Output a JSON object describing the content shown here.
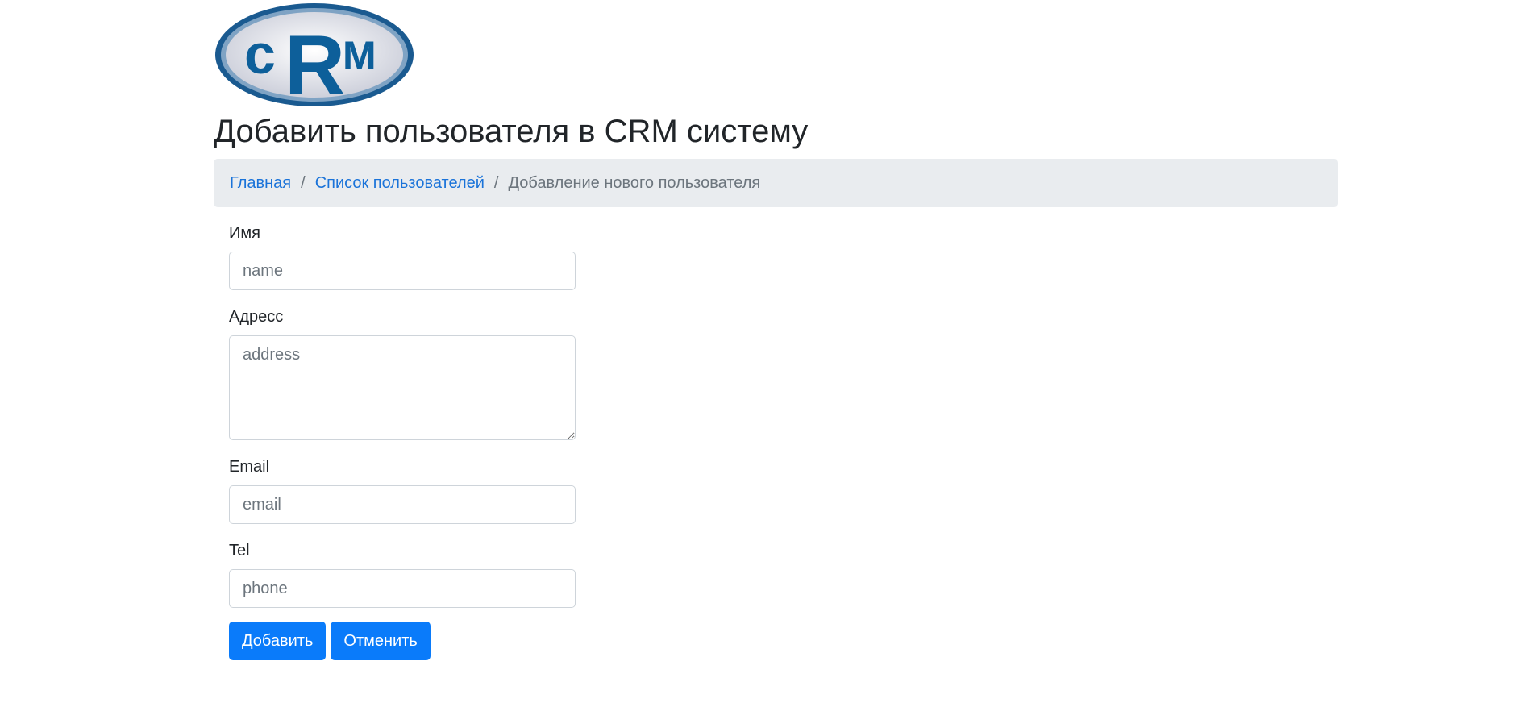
{
  "logo": {
    "text_c": "c",
    "text_r": "R",
    "text_m": "M",
    "colors": {
      "ring": "#1a5a90",
      "fill": "#dde0ea",
      "letters": "#0d5f9a"
    }
  },
  "header": {
    "title": "Добавить пользователя в CRM систему"
  },
  "breadcrumb": {
    "home": "Главная",
    "sep1": "/",
    "users": "Список пользователей",
    "sep2": "/",
    "current": "Добавление нового пользователя"
  },
  "form": {
    "name": {
      "label": "Имя",
      "placeholder": "name",
      "value": ""
    },
    "address": {
      "label": "Адресс",
      "placeholder": "address",
      "value": ""
    },
    "email": {
      "label": "Email",
      "placeholder": "email",
      "value": ""
    },
    "tel": {
      "label": "Tel",
      "placeholder": "phone",
      "value": ""
    },
    "submit_label": "Добавить",
    "cancel_label": "Отменить"
  },
  "colors": {
    "accent": "#0a7bfa",
    "link": "#1a73d9",
    "breadcrumb_bg": "#e9ecef"
  }
}
